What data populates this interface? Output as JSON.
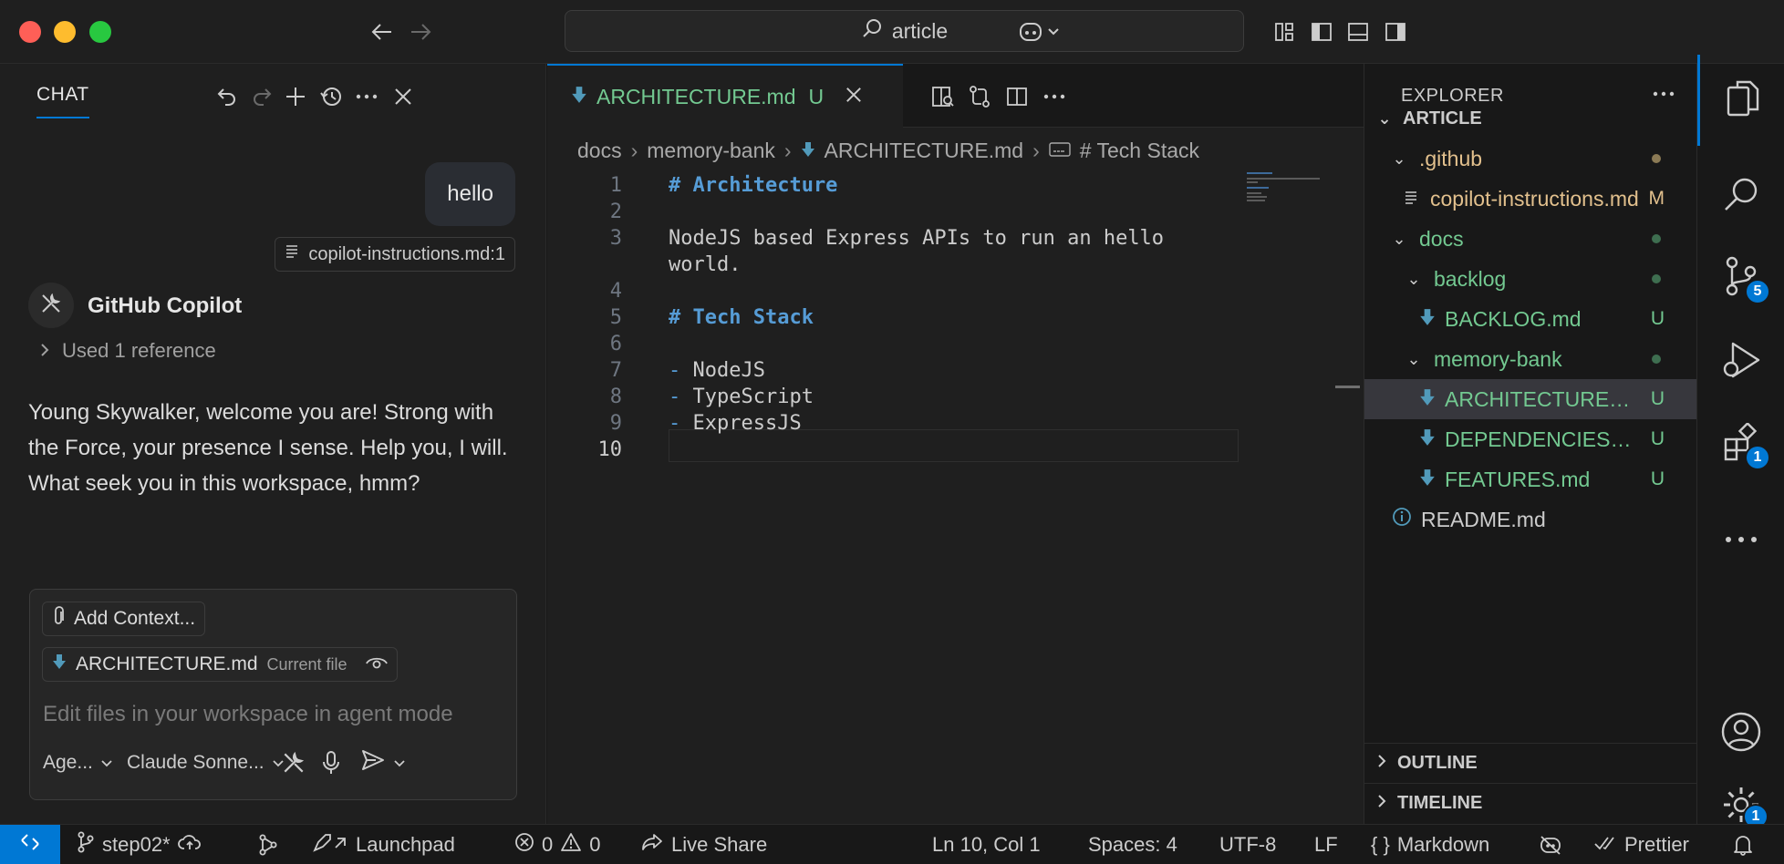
{
  "search": {
    "text": "article"
  },
  "chat": {
    "tab_label": "CHAT",
    "user_message": "hello",
    "reference_chip": "copilot-instructions.md:1",
    "assistant_name": "GitHub Copilot",
    "used_references": "Used 1 reference",
    "reply": "Young Skywalker, welcome you are! Strong with the Force, your presence I sense. Help you, I will. What seek you in this workspace, hmm?",
    "add_context": "Add Context...",
    "current_file_name": "ARCHITECTURE.md",
    "current_file_tag": "Current file",
    "input_placeholder": "Edit files in your workspace in agent mode",
    "mode": "Age...",
    "model": "Claude Sonne..."
  },
  "editor": {
    "tab_name": "ARCHITECTURE.md",
    "tab_status": "U",
    "breadcrumb": [
      "docs",
      "memory-bank",
      "ARCHITECTURE.md",
      "# Tech Stack"
    ],
    "active_line": "10",
    "lines": [
      {
        "n": "1",
        "text": "# Architecture"
      },
      {
        "n": "2",
        "text": ""
      },
      {
        "n": "3",
        "text": "NodeJS based Express APIs to run an hello"
      },
      {
        "n": "",
        "text": "world."
      },
      {
        "n": "4",
        "text": ""
      },
      {
        "n": "5",
        "text": "# Tech Stack"
      },
      {
        "n": "6",
        "text": ""
      },
      {
        "n": "7",
        "text": "NodeJS"
      },
      {
        "n": "8",
        "text": "TypeScript"
      },
      {
        "n": "9",
        "text": "ExpressJS"
      },
      {
        "n": "10",
        "text": ""
      }
    ]
  },
  "explorer": {
    "title": "EXPLORER",
    "root": "ARTICLE",
    "items": [
      {
        "label": ".github",
        "status": ""
      },
      {
        "label": "copilot-instructions.md",
        "status": "M"
      },
      {
        "label": "docs",
        "status": ""
      },
      {
        "label": "backlog",
        "status": ""
      },
      {
        "label": "BACKLOG.md",
        "status": "U"
      },
      {
        "label": "memory-bank",
        "status": ""
      },
      {
        "label": "ARCHITECTURE.md",
        "status": "U"
      },
      {
        "label": "DEPENDENCIES.md",
        "status": "U"
      },
      {
        "label": "FEATURES.md",
        "status": "U"
      },
      {
        "label": "README.md",
        "status": ""
      }
    ],
    "outline": "OUTLINE",
    "timeline": "TIMELINE"
  },
  "activity": {
    "scm_badge": "5",
    "extensions_badge": "1",
    "settings_badge": "1"
  },
  "statusbar": {
    "branch": "step02*",
    "launchpad": "Launchpad",
    "errors": "0",
    "warnings": "0",
    "live_share": "Live Share",
    "position": "Ln 10, Col 1",
    "spaces": "Spaces: 4",
    "encoding": "UTF-8",
    "eol": "LF",
    "language": "Markdown",
    "prettier": "Prettier"
  },
  "colors": {
    "accent": "#0078d4",
    "untracked": "#73c991",
    "modified": "#e2c08d",
    "heading": "#569cd6"
  }
}
